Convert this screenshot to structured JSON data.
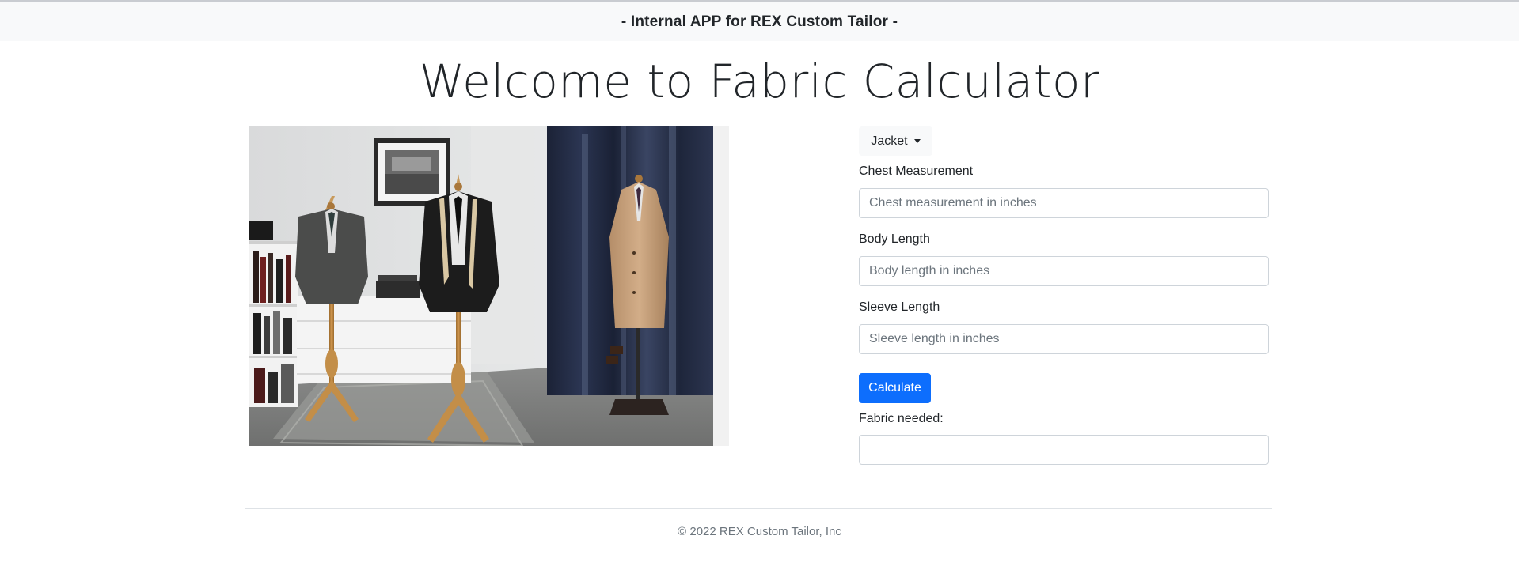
{
  "header": {
    "title": "- Internal APP for REX Custom Tailor -"
  },
  "main": {
    "title": "Welcome to Fabric Calculator",
    "garment_dropdown": {
      "selected": "Jacket"
    },
    "form": {
      "chest": {
        "label": "Chest Measurement",
        "placeholder": "Chest measurement in inches",
        "value": ""
      },
      "body_length": {
        "label": "Body Length",
        "placeholder": "Body length in inches",
        "value": ""
      },
      "sleeve_length": {
        "label": "Sleeve Length",
        "placeholder": "Sleeve length in inches",
        "value": ""
      },
      "calculate_label": "Calculate",
      "result": {
        "label": "Fabric needed:",
        "value": ""
      }
    },
    "icons": {
      "dropdown": "caret-down-icon"
    }
  },
  "footer": {
    "text": "© 2022 REX Custom Tailor, Inc"
  },
  "colors": {
    "primary": "#0d6efd",
    "header_bg": "#f8f9fa",
    "text": "#212529",
    "muted": "#6c757d"
  }
}
